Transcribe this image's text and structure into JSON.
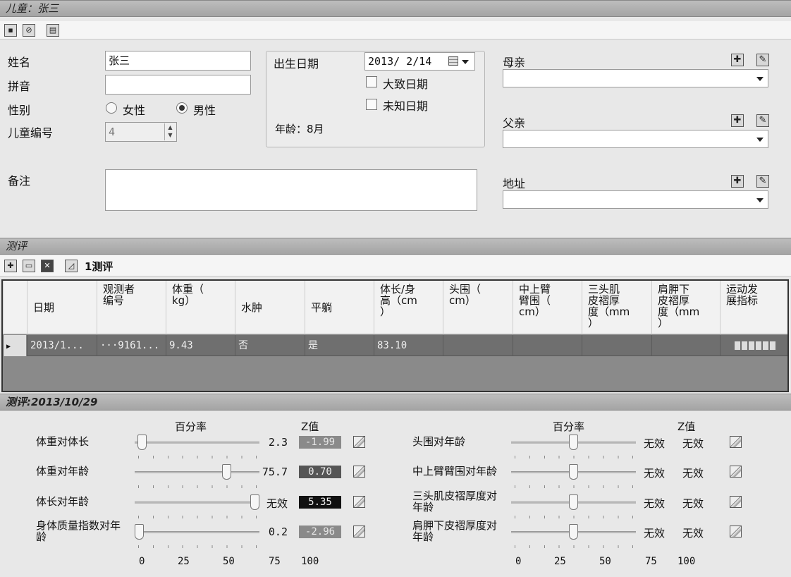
{
  "child_header": "儿童：张三",
  "form": {
    "name_label": "姓名",
    "name_value": "张三",
    "pinyin_label": "拼音",
    "pinyin_value": "",
    "gender_label": "性别",
    "female_label": "女性",
    "male_label": "男性",
    "gender_selected": "男性",
    "child_no_label": "儿童编号",
    "child_no_value": "4",
    "note_label": "备注",
    "note_value": "",
    "birth_label": "出生日期",
    "birth_value": "2013/ 2/14",
    "approx_date_label": "大致日期",
    "unknown_date_label": "未知日期",
    "age_text": "年龄：8月",
    "mother_label": "母亲",
    "father_label": "父亲",
    "address_label": "地址"
  },
  "assessment_header": "测评",
  "assessment_toolbar": {
    "count_label": "1测评"
  },
  "grid": {
    "columns": [
      "日期",
      "观测者\n编号",
      "体重（\nkg）",
      "水肿",
      "平躺",
      "体长/身\n高（cm\n）",
      "头围（\ncm）",
      "中上臂\n臂围（\ncm）",
      "三头肌\n皮褶厚\n度（mm\n）",
      "肩胛下\n皮褶厚\n度（mm\n）",
      "运动发\n展指标"
    ],
    "rows": [
      [
        "2013/1...",
        "···9161...",
        "9.43",
        "否",
        "是",
        "83.10",
        "",
        "",
        "",
        "",
        ""
      ]
    ]
  },
  "detail_header": "测评:2013/10/29",
  "detail": {
    "percentile_label": "百分率",
    "z_label": "Z值",
    "scale": [
      "0",
      "25",
      "50",
      "75",
      "100"
    ],
    "left": [
      {
        "label": "体重对体长",
        "percentile": 2.3,
        "percentile_text": "2.3",
        "z": "-1.99",
        "z_style": "mid"
      },
      {
        "label": "体重对年龄",
        "percentile": 75.7,
        "percentile_text": "75.7",
        "z": "0.70",
        "z_style": "dark"
      },
      {
        "label": "体长对年龄",
        "percentile": 100,
        "percentile_text": "无效",
        "z": "5.35",
        "z_style": "black"
      },
      {
        "label": "身体质量指数对年\n龄",
        "percentile": 0.2,
        "percentile_text": "0.2",
        "z": "-2.96",
        "z_style": "mid"
      }
    ],
    "right": [
      {
        "label": "头围对年龄",
        "percentile": 50,
        "percentile_text": "无效",
        "z": "无效"
      },
      {
        "label": "中上臂臂围对年龄",
        "percentile": 50,
        "percentile_text": "无效",
        "z": "无效"
      },
      {
        "label": "三头肌皮褶厚度对\n年龄",
        "percentile": 50,
        "percentile_text": "无效",
        "z": "无效"
      },
      {
        "label": "肩胛下皮褶厚度对\n年龄",
        "percentile": 50,
        "percentile_text": "无效",
        "z": "无效"
      }
    ]
  },
  "icons": {
    "save": "save-icon",
    "cancel": "cancel-icon",
    "report": "report-icon",
    "add": "add-icon",
    "open": "open-folder-icon",
    "delete": "delete-icon",
    "chart": "chart-icon",
    "edit": "edit-icon",
    "calendar": "calendar-icon"
  }
}
